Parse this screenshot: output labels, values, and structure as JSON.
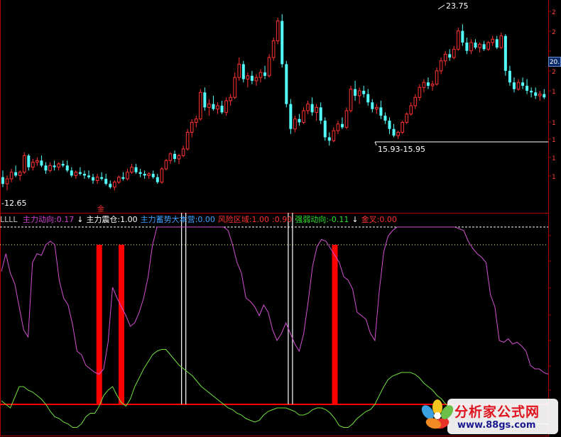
{
  "price_axis": {
    "visible_ticks": [
      "2",
      "2",
      "20",
      "2",
      "1",
      "1",
      "1",
      "1",
      "1"
    ],
    "current_price_label": "20."
  },
  "annotations": {
    "high_label": "23.75",
    "low_label": "-12.65",
    "range_label": "15.93-15.95",
    "marker": "金"
  },
  "legend": {
    "prefix": "LLLL",
    "items": [
      {
        "text": "主力动向:0.17",
        "color": "#d040d0"
      },
      {
        "text": "↓",
        "color": "#ffffff"
      },
      {
        "text": "主力震仓:1.00",
        "color": "#ffffff"
      },
      {
        "text": "主力蓄势大本营:0.00",
        "color": "#40a0ff"
      },
      {
        "text": "风险区域:1.00",
        "color": "#ff3030"
      },
      {
        "text": ":0.90",
        "color": "#ff3030"
      },
      {
        "text": "强弱动向:-0.11",
        "color": "#30e030"
      },
      {
        "text": "↓",
        "color": "#ffffff"
      },
      {
        "text": "金叉:0.00",
        "color": "#ff3030"
      }
    ]
  },
  "watermark": {
    "title": "分析家公式网",
    "url": "www.88gs.com"
  },
  "colors": {
    "up_candle": "#ff3232",
    "down_candle": "#54ffff",
    "border": "#b00000",
    "magenta": "#d050d0",
    "green": "#70e040",
    "white": "#ffffff",
    "red_bar": "#ff0000"
  },
  "chart_data": [
    {
      "type": "candlestick",
      "title": "",
      "ylim": [
        12,
        24.5
      ],
      "notes": "Approximate daily candles, values read from the chart",
      "candles": [
        [
          13.6,
          14.0,
          13.0,
          13.2
        ],
        [
          13.2,
          13.7,
          12.8,
          13.5
        ],
        [
          13.5,
          14.1,
          13.3,
          13.9
        ],
        [
          13.9,
          14.3,
          13.6,
          13.7
        ],
        [
          13.7,
          14.0,
          13.4,
          13.9
        ],
        [
          13.9,
          15.1,
          13.8,
          14.9
        ],
        [
          14.9,
          15.0,
          14.0,
          14.2
        ],
        [
          14.2,
          14.7,
          14.0,
          14.5
        ],
        [
          14.5,
          14.8,
          14.3,
          14.6
        ],
        [
          14.6,
          14.9,
          14.2,
          14.3
        ],
        [
          14.3,
          14.5,
          13.8,
          14.0
        ],
        [
          14.0,
          14.5,
          13.9,
          14.3
        ],
        [
          14.3,
          14.6,
          14.0,
          14.2
        ],
        [
          14.2,
          14.5,
          14.0,
          14.4
        ],
        [
          14.4,
          14.6,
          14.2,
          14.3
        ],
        [
          14.3,
          14.6,
          13.9,
          14.0
        ],
        [
          14.0,
          14.2,
          13.6,
          13.7
        ],
        [
          13.7,
          14.0,
          13.5,
          13.9
        ],
        [
          13.9,
          14.2,
          13.7,
          13.8
        ],
        [
          13.8,
          14.0,
          13.5,
          13.7
        ],
        [
          13.7,
          14.0,
          13.5,
          13.6
        ],
        [
          13.6,
          13.8,
          13.2,
          13.4
        ],
        [
          13.4,
          13.8,
          13.2,
          13.6
        ],
        [
          13.6,
          13.9,
          13.4,
          13.5
        ],
        [
          13.5,
          13.8,
          13.1,
          13.2
        ],
        [
          13.2,
          13.4,
          12.9,
          13.0
        ],
        [
          13.0,
          13.4,
          12.8,
          13.3
        ],
        [
          13.3,
          13.7,
          13.2,
          13.6
        ],
        [
          13.6,
          13.9,
          13.4,
          13.5
        ],
        [
          13.5,
          14.1,
          13.4,
          13.9
        ],
        [
          13.9,
          14.4,
          13.8,
          14.2
        ],
        [
          14.2,
          14.4,
          13.8,
          13.9
        ],
        [
          13.9,
          14.1,
          13.6,
          13.8
        ],
        [
          13.8,
          14.0,
          13.5,
          13.7
        ],
        [
          13.7,
          13.9,
          13.5,
          13.8
        ],
        [
          13.8,
          14.0,
          13.5,
          13.6
        ],
        [
          13.6,
          13.8,
          13.2,
          13.3
        ],
        [
          13.3,
          14.2,
          13.2,
          14.1
        ],
        [
          14.1,
          14.7,
          14.0,
          14.6
        ],
        [
          14.6,
          15.1,
          14.4,
          15.0
        ],
        [
          15.0,
          15.2,
          14.5,
          14.7
        ],
        [
          14.7,
          15.0,
          14.4,
          14.9
        ],
        [
          14.9,
          15.5,
          14.8,
          15.3
        ],
        [
          15.3,
          16.5,
          15.2,
          16.3
        ],
        [
          16.3,
          17.1,
          16.0,
          16.9
        ],
        [
          16.9,
          17.3,
          16.6,
          17.1
        ],
        [
          17.1,
          18.9,
          17.0,
          18.7
        ],
        [
          18.7,
          19.0,
          17.6,
          17.8
        ],
        [
          17.8,
          18.3,
          17.3,
          18.0
        ],
        [
          18.0,
          18.5,
          17.6,
          17.7
        ],
        [
          17.7,
          18.1,
          17.4,
          17.9
        ],
        [
          17.9,
          18.2,
          17.4,
          17.5
        ],
        [
          17.5,
          18.4,
          17.3,
          18.2
        ],
        [
          18.2,
          18.6,
          17.9,
          18.4
        ],
        [
          18.4,
          19.9,
          18.3,
          19.6
        ],
        [
          19.6,
          20.8,
          19.4,
          20.4
        ],
        [
          20.4,
          20.6,
          19.3,
          19.5
        ],
        [
          19.5,
          19.9,
          19.0,
          19.7
        ],
        [
          19.7,
          20.0,
          19.2,
          19.4
        ],
        [
          19.4,
          19.8,
          19.1,
          19.6
        ],
        [
          19.6,
          20.1,
          19.3,
          19.9
        ],
        [
          19.9,
          20.3,
          19.5,
          19.7
        ],
        [
          19.7,
          21.0,
          19.6,
          20.8
        ],
        [
          20.8,
          22.0,
          20.6,
          21.8
        ],
        [
          21.8,
          23.2,
          21.6,
          23.0
        ],
        [
          23.0,
          23.4,
          20.2,
          20.4
        ],
        [
          20.4,
          20.6,
          17.8,
          18.0
        ],
        [
          18.0,
          18.3,
          16.2,
          16.5
        ],
        [
          16.5,
          17.3,
          16.3,
          17.1
        ],
        [
          17.1,
          17.4,
          16.7,
          16.9
        ],
        [
          16.9,
          17.8,
          16.8,
          17.6
        ],
        [
          17.6,
          18.2,
          17.4,
          18.0
        ],
        [
          18.0,
          18.4,
          17.3,
          17.5
        ],
        [
          17.5,
          18.0,
          17.0,
          17.8
        ],
        [
          17.8,
          18.1,
          16.8,
          17.0
        ],
        [
          17.0,
          17.2,
          15.8,
          16.0
        ],
        [
          16.0,
          16.3,
          15.5,
          15.8
        ],
        [
          15.8,
          16.6,
          15.7,
          16.4
        ],
        [
          16.4,
          17.0,
          16.2,
          16.8
        ],
        [
          16.8,
          17.2,
          16.5,
          16.6
        ],
        [
          16.6,
          17.8,
          16.5,
          17.6
        ],
        [
          17.6,
          19.1,
          17.5,
          18.9
        ],
        [
          18.9,
          19.4,
          18.2,
          18.5
        ],
        [
          18.5,
          19.0,
          18.0,
          18.8
        ],
        [
          18.8,
          19.1,
          18.4,
          18.6
        ],
        [
          18.6,
          18.9,
          17.9,
          18.1
        ],
        [
          18.1,
          18.3,
          17.5,
          17.7
        ],
        [
          17.7,
          18.0,
          17.4,
          17.8
        ],
        [
          17.8,
          18.2,
          17.1,
          17.3
        ],
        [
          17.3,
          17.5,
          16.8,
          17.0
        ],
        [
          17.0,
          17.2,
          16.2,
          16.5
        ],
        [
          16.5,
          16.8,
          16.0,
          16.1
        ],
        [
          16.1,
          16.4,
          15.9,
          16.3
        ],
        [
          16.3,
          17.0,
          16.2,
          16.9
        ],
        [
          16.9,
          17.5,
          16.8,
          17.4
        ],
        [
          17.4,
          18.1,
          17.3,
          17.9
        ],
        [
          17.9,
          18.6,
          17.7,
          18.4
        ],
        [
          18.4,
          19.2,
          18.2,
          19.0
        ],
        [
          19.0,
          19.5,
          18.7,
          19.3
        ],
        [
          19.3,
          19.6,
          18.9,
          19.1
        ],
        [
          19.1,
          19.4,
          18.8,
          19.2
        ],
        [
          19.2,
          20.2,
          19.1,
          20.0
        ],
        [
          20.0,
          20.8,
          19.8,
          20.6
        ],
        [
          20.6,
          21.2,
          20.3,
          21.0
        ],
        [
          21.0,
          21.3,
          20.6,
          20.8
        ],
        [
          20.8,
          21.5,
          20.7,
          21.3
        ],
        [
          21.3,
          22.6,
          21.2,
          22.4
        ],
        [
          22.4,
          22.8,
          21.5,
          21.7
        ],
        [
          21.7,
          22.0,
          21.0,
          21.2
        ],
        [
          21.2,
          21.9,
          21.0,
          21.7
        ],
        [
          21.7,
          21.9,
          21.3,
          21.4
        ],
        [
          21.4,
          21.7,
          21.1,
          21.6
        ],
        [
          21.6,
          21.8,
          21.2,
          21.3
        ],
        [
          21.3,
          21.8,
          21.2,
          21.7
        ],
        [
          21.7,
          22.1,
          21.5,
          21.9
        ],
        [
          21.9,
          22.1,
          21.3,
          21.4
        ],
        [
          21.4,
          22.3,
          21.3,
          22.1
        ],
        [
          22.1,
          22.2,
          19.7,
          20.0
        ],
        [
          20.0,
          20.3,
          19.1,
          19.3
        ],
        [
          19.3,
          19.6,
          18.7,
          18.9
        ],
        [
          18.9,
          19.5,
          18.8,
          19.3
        ],
        [
          19.3,
          19.6,
          18.9,
          19.1
        ],
        [
          19.1,
          19.5,
          18.6,
          18.8
        ],
        [
          18.8,
          19.0,
          18.4,
          18.7
        ],
        [
          18.7,
          19.0,
          18.3,
          18.5
        ],
        [
          18.5,
          18.8,
          18.2,
          18.6
        ],
        [
          18.6,
          18.9,
          18.3,
          18.4
        ]
      ]
    },
    {
      "type": "line",
      "title": "",
      "ylim": [
        -0.15,
        1.15
      ],
      "series": [
        {
          "name": "主力动向",
          "values": [
            0.75,
            0.85,
            0.74,
            0.68,
            0.55,
            0.42,
            0.38,
            0.8,
            0.85,
            0.84,
            0.9,
            0.92,
            0.9,
            0.7,
            0.6,
            0.56,
            0.45,
            0.3,
            0.28,
            0.22,
            0.2,
            0.18,
            0.17,
            0.2,
            0.35,
            0.66,
            0.6,
            0.55,
            0.5,
            0.44,
            0.46,
            0.52,
            0.6,
            0.72,
            0.9,
            1.0,
            1.0,
            1.0,
            1.0,
            1.0,
            1.0,
            1.0,
            1.0,
            1.0,
            1.0,
            1.0,
            1.0,
            1.0,
            1.0,
            1.0,
            1.0,
            0.98,
            0.9,
            0.8,
            0.74,
            0.6,
            0.58,
            0.55,
            0.5,
            0.56,
            0.52,
            0.42,
            0.36,
            0.4,
            0.46,
            0.4,
            0.34,
            0.3,
            0.4,
            0.58,
            0.78,
            0.89,
            0.93,
            0.92,
            0.88,
            0.84,
            0.8,
            0.72,
            0.7,
            0.65,
            0.52,
            0.5,
            0.48,
            0.4,
            0.36,
            0.64,
            0.86,
            0.95,
            0.98,
            1.0,
            1.0,
            1.0,
            1.0,
            1.0,
            1.0,
            1.0,
            1.0,
            1.0,
            1.0,
            1.0,
            1.0,
            1.0,
            1.0,
            0.99,
            0.98,
            0.92,
            0.88,
            0.85,
            0.83,
            0.8,
            0.62,
            0.55,
            0.36,
            0.35,
            0.37,
            0.34,
            0.35,
            0.33,
            0.3,
            0.22,
            0.2,
            0.2,
            0.18,
            0.17
          ]
        },
        {
          "name": "强弱动向",
          "values": [
            0.02,
            0.0,
            -0.02,
            0.04,
            0.1,
            0.1,
            0.08,
            0.07,
            0.05,
            0.03,
            0.0,
            -0.04,
            -0.07,
            -0.08,
            -0.1,
            -0.11,
            -0.13,
            -0.13,
            -0.11,
            -0.07,
            -0.05,
            -0.05,
            -0.01,
            0.05,
            0.08,
            0.1,
            0.05,
            0.01,
            -0.01,
            0.03,
            0.1,
            0.15,
            0.2,
            0.24,
            0.28,
            0.3,
            0.31,
            0.31,
            0.28,
            0.25,
            0.22,
            0.2,
            0.18,
            0.16,
            0.13,
            0.1,
            0.08,
            0.06,
            0.04,
            0.02,
            0.0,
            -0.02,
            -0.03,
            -0.05,
            -0.06,
            -0.08,
            -0.09,
            -0.1,
            -0.09,
            -0.06,
            -0.04,
            -0.03,
            -0.02,
            -0.02,
            -0.02,
            -0.03,
            -0.04,
            -0.06,
            -0.06,
            -0.05,
            -0.03,
            -0.02,
            -0.02,
            -0.03,
            -0.05,
            -0.08,
            -0.12,
            -0.13,
            -0.13,
            -0.11,
            -0.08,
            -0.06,
            -0.04,
            -0.03,
            0.0,
            0.05,
            0.1,
            0.14,
            0.16,
            0.17,
            0.18,
            0.18,
            0.18,
            0.17,
            0.15,
            0.12,
            0.1,
            0.08,
            0.05,
            0.03,
            0.0,
            -0.02,
            -0.04,
            -0.06,
            -0.08,
            -0.1,
            -0.11,
            -0.12,
            -0.12,
            -0.11,
            -0.1,
            -0.09,
            -0.08,
            -0.09,
            -0.1,
            -0.11,
            -0.11,
            -0.11,
            -0.11,
            -0.11,
            -0.11,
            -0.11,
            -0.11,
            -0.11
          ]
        }
      ],
      "spikes": [
        {
          "series": "主力震仓",
          "index": 41,
          "value": 1.0
        },
        {
          "series": "主力震仓",
          "index": 65,
          "value": 1.0
        }
      ],
      "red_bars": [
        {
          "index": 22,
          "value": 0.9
        },
        {
          "index": 27,
          "value": 0.9
        },
        {
          "index": 75,
          "value": 0.9
        }
      ],
      "reference_lines": [
        {
          "value": 1.0,
          "style": "dashed",
          "color": "#ffffff"
        },
        {
          "value": 0.9,
          "style": "dotted",
          "color": "#ffff80"
        },
        {
          "value": 0.0,
          "style": "solid",
          "color": "#ff0000"
        }
      ]
    }
  ]
}
